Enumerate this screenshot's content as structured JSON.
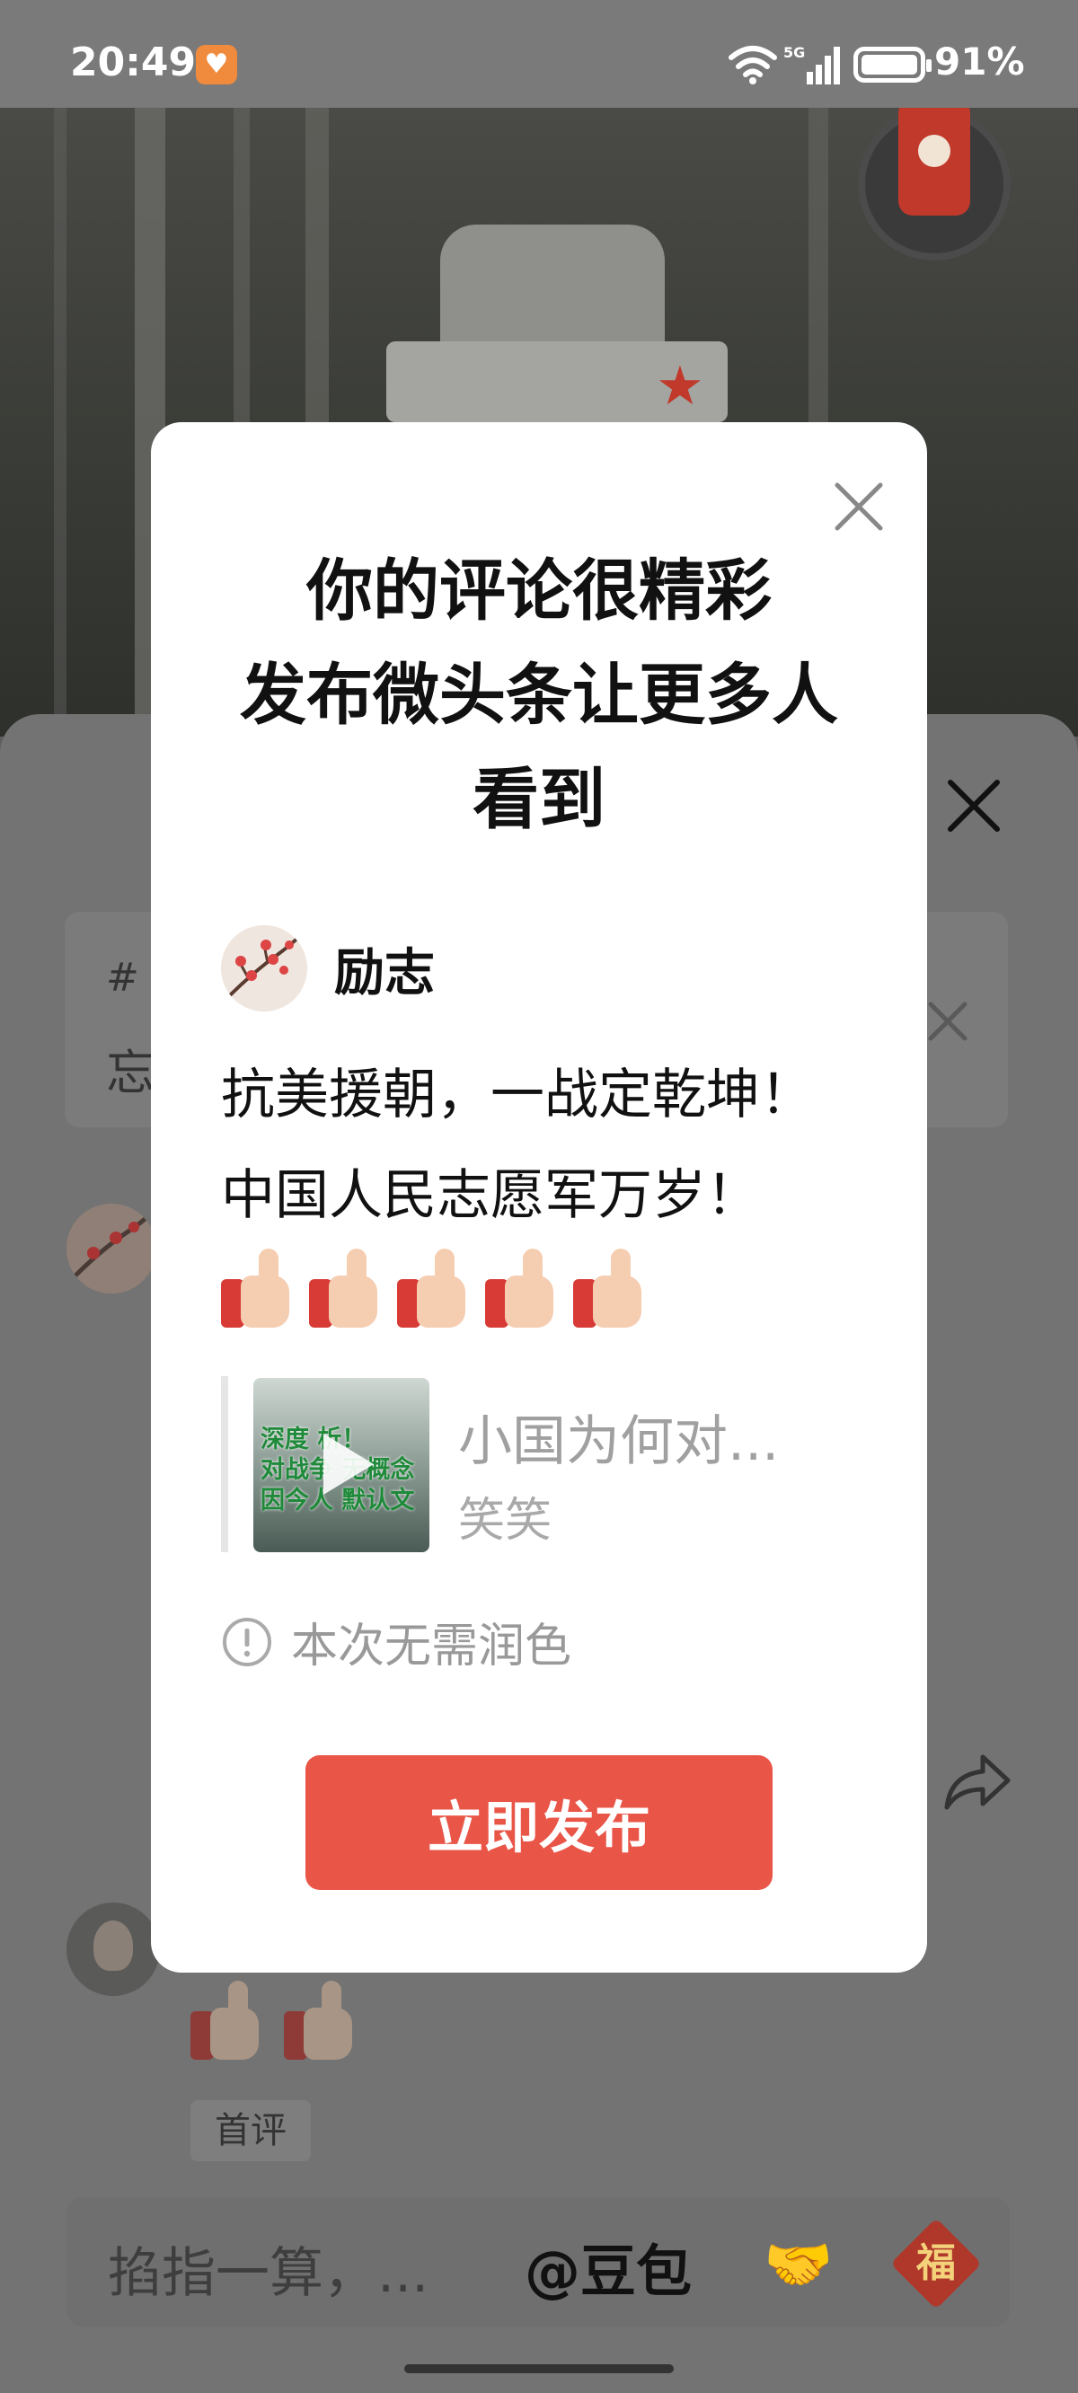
{
  "status_bar": {
    "time": "20:49",
    "battery": "91%",
    "network": "5G"
  },
  "topic_card": {
    "text": "忘"
  },
  "bottom_comment": {
    "tag": "首评"
  },
  "comment_input": {
    "placeholder": "掐指一算，...",
    "mention": "@豆包"
  },
  "dialog": {
    "title_lines": [
      "你的评论很精彩",
      "发布微头条让更多人",
      "看到"
    ],
    "author_name": "励志",
    "post_lines": [
      "抗美援朝，一战定乾坤！",
      "中国人民志愿军万岁！"
    ],
    "quote": {
      "thumbnail_text": [
        "深度  析！",
        "对战争    无概念",
        "因今人    默认文"
      ],
      "title": "小国为何对...",
      "author": "笑笑"
    },
    "notice": "本次无需润色",
    "publish_button": "立即发布"
  },
  "colors": {
    "accent": "#e95547",
    "dim_overlay": "#737373"
  }
}
